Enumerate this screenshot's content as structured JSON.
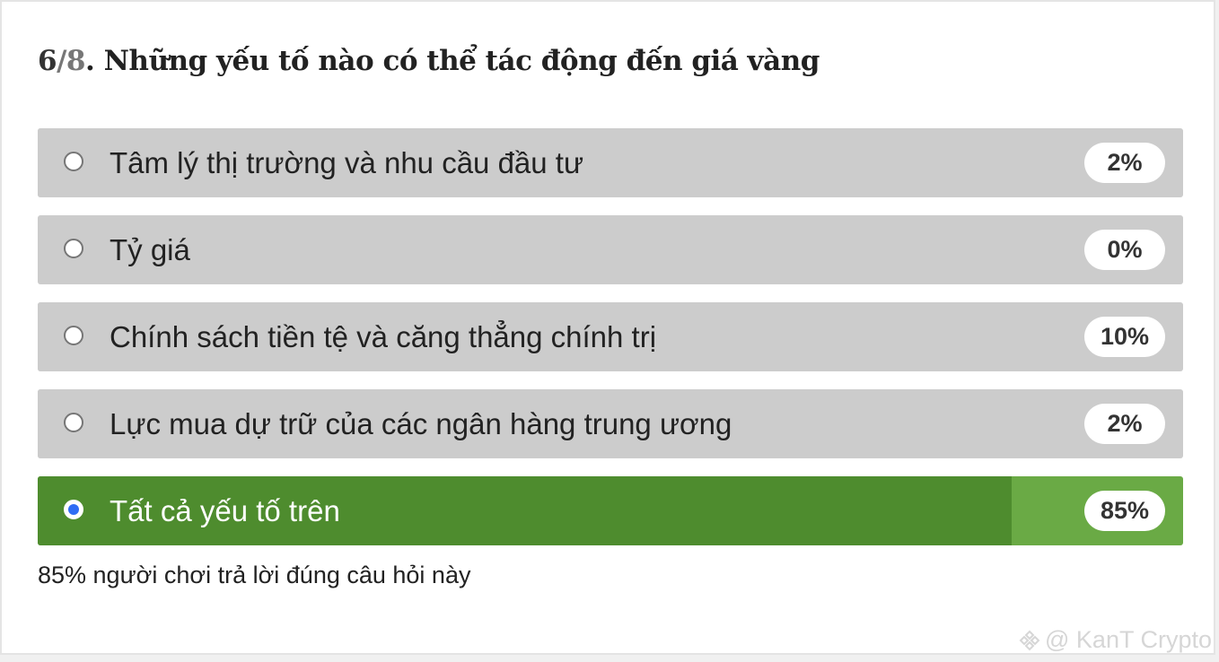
{
  "question": {
    "number": "6",
    "separator": "/",
    "total": "8",
    "text": ". Những yếu tố nào có thể tác động đến giá vàng"
  },
  "options": [
    {
      "label": "Tâm lý thị trường và nhu cầu đầu tư",
      "percent_label": "2%",
      "percent": 2,
      "selected": false,
      "correct": false
    },
    {
      "label": "Tỷ giá",
      "percent_label": "0%",
      "percent": 0,
      "selected": false,
      "correct": false
    },
    {
      "label": "Chính sách tiền tệ và căng thẳng chính trị",
      "percent_label": "10%",
      "percent": 10,
      "selected": false,
      "correct": false
    },
    {
      "label": "Lực mua dự trữ của các ngân hàng trung ương",
      "percent_label": "2%",
      "percent": 2,
      "selected": false,
      "correct": false
    },
    {
      "label": "Tất cả yếu tố trên",
      "percent_label": "85%",
      "percent": 85,
      "selected": true,
      "correct": true
    }
  ],
  "stat_text": "85% người chơi trả lời đúng câu hỏi này",
  "watermark": {
    "text": "@ KanT Crypto",
    "icon": "binance-logo-icon"
  },
  "colors": {
    "correct_fill": "#4e8c2e",
    "correct_track": "#6aaa45",
    "option_bg": "#cccccc",
    "radio_selected": "#2f6df4"
  }
}
